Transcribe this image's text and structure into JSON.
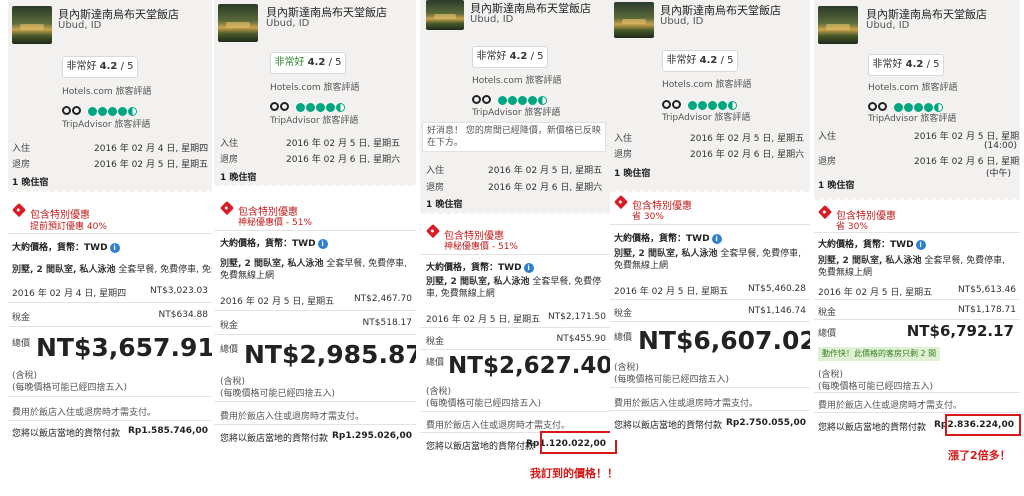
{
  "hotel": {
    "name": "貝內斯達南烏布天堂飯店",
    "city": "Ubud, ID"
  },
  "review_labels": {
    "hotels_com": "Hotels.com 旅客評語",
    "tripadvisor": "TripAdvisor 旅客評語",
    "rating_label": "非常好",
    "rating_value": "4.2",
    "rating_max": "/ 5"
  },
  "labels": {
    "checkin": "入住",
    "checkout": "退房",
    "nights": "1 晚住宿",
    "deal": "包含特別優惠",
    "price_currency": "大約價格，貨幣：",
    "currency": "TWD",
    "room_type": "別墅, 2 間臥室, 私人泳池",
    "room_extra": "全套早餐, 免費停車, 免費無線上網",
    "tax": "稅金",
    "total": "總價",
    "tax_included": "(含稅)",
    "rounding": "(每晚價格可能已經四捨五入)",
    "pay_at_hotel": "費用於飯店入住或退房時才需支付。",
    "local_currency": "您將以飯店當地的貨幣付款",
    "price_drop_notice": "好消息！ 您的房間已經降價，新價格已反映在下方。",
    "quick_note": "動作快！此價格的客房只剩 2 間"
  },
  "panels": [
    {
      "checkin": "2016 年 02 月 4 日, 星期四",
      "checkout": "2016 年 02 月 5 日, 星期五",
      "deal_sub": "提前預訂優惠 40%",
      "date_row": "2016 年 02 月 4 日, 星期四",
      "nightly": "NT$3,023.03",
      "tax": "NT$634.88",
      "total": "NT$3,657.91",
      "local": "Rp1.585.746,00"
    },
    {
      "checkin": "2016 年 02 月 5 日, 星期五",
      "checkout": "2016 年 02 月 6 日, 星期六",
      "deal_sub": "神秘優惠價 - 51%",
      "date_row": "2016 年 02 月 5 日, 星期五",
      "nightly": "NT$2,467.70",
      "tax": "NT$518.17",
      "total": "NT$2,985.87",
      "local": "Rp1.295.026,00"
    },
    {
      "checkin": "2016 年 02 月 5 日, 星期五",
      "checkout": "2016 年 02 月 6 日, 星期六",
      "deal_sub": "神秘優惠價 - 51%",
      "date_row": "2016 年 02 月 5 日, 星期五",
      "nightly": "NT$2,171.50",
      "tax": "NT$455.90",
      "total": "NT$2,627.40",
      "local": "Rp1.120.022,00"
    },
    {
      "checkin": "2016 年 02 月 5 日, 星期五",
      "checkout": "2016 年 02 月 6 日, 星期六",
      "deal_sub": "省 30%",
      "date_row": "2016 年 02 月 5 日, 星期五",
      "nightly": "NT$5,460.28",
      "tax": "NT$1,146.74",
      "total": "NT$6,607.02",
      "local": "Rp2.750.055,00"
    },
    {
      "checkin": "2016 年 02 月 5 日, 星期五",
      "checkin_time": "(14:00)",
      "checkout": "2016 年 02 月 6 日, 星期六",
      "checkout_time": "(中午)",
      "deal_sub": "省 30%",
      "date_row": "2016 年 02 月 5 日, 星期五",
      "nightly": "NT$5,613.46",
      "tax": "NT$1,178.71",
      "total": "NT$6,792.17",
      "local": "Rp2.836.224,00"
    }
  ],
  "annotations": {
    "booked": "我訂到的價格！！",
    "doubled": "漲了2倍多！"
  },
  "colors": {
    "annotation_red": "#d61a1a",
    "deal_red": "#c01a1a",
    "tripadvisor_green": "#00a680"
  }
}
